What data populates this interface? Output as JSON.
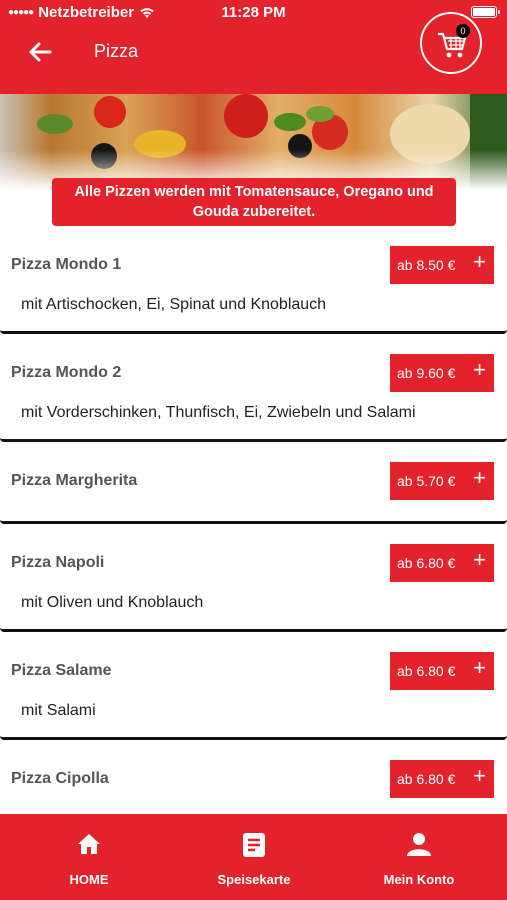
{
  "status": {
    "carrier": "Netzbetreiber",
    "time": "11:28 PM",
    "signal_icon": "signal-dots-icon",
    "wifi_icon": "wifi-icon",
    "battery_icon": "battery-icon"
  },
  "header": {
    "title": "Pizza",
    "back_icon": "arrow-left-icon",
    "cart_icon": "shopping-cart-icon",
    "cart_count": "0"
  },
  "notice": "Alle Pizzen werden mit Tomatensauce, Oregano und Gouda zubereitet.",
  "items": [
    {
      "name": "Pizza Mondo 1",
      "price": "ab 8.50 €",
      "desc": "mit Artischocken, Ei, Spinat und Knoblauch"
    },
    {
      "name": "Pizza Mondo 2",
      "price": "ab 9.60 €",
      "desc": "mit Vorderschinken, Thunfisch, Ei, Zwiebeln und Salami"
    },
    {
      "name": "Pizza Margherita",
      "price": "ab 5.70 €",
      "desc": ""
    },
    {
      "name": "Pizza Napoli",
      "price": "ab 6.80 €",
      "desc": "mit Oliven und Knoblauch"
    },
    {
      "name": "Pizza Salame",
      "price": "ab 6.80 €",
      "desc": "mit Salami"
    },
    {
      "name": "Pizza Cipolla",
      "price": "ab 6.80 €",
      "desc": ""
    }
  ],
  "add_label": "+",
  "tabs": [
    {
      "label": "HOME",
      "icon": "home-icon"
    },
    {
      "label": "Speisekarte",
      "icon": "menu-list-icon"
    },
    {
      "label": "Mein Konto",
      "icon": "user-icon"
    }
  ],
  "colors": {
    "brand": "#e3222b",
    "text": "#222222",
    "name": "#555555"
  }
}
